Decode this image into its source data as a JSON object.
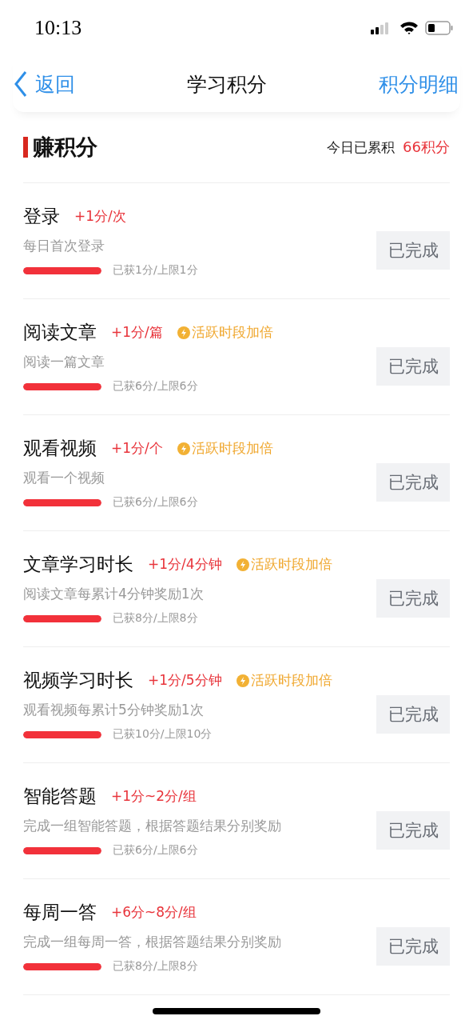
{
  "status_bar": {
    "time": "10:13"
  },
  "nav": {
    "back": "返回",
    "title": "学习积分",
    "action": "积分明细"
  },
  "section": {
    "title": "赚积分",
    "today_label": "今日已累积",
    "today_value": "66积分"
  },
  "tasks": [
    {
      "title": "登录",
      "rate": "+1分/次",
      "desc": "每日首次登录",
      "level": 1,
      "progress": "已获1分/上限1分",
      "button": "已完成",
      "completed": true
    },
    {
      "title": "阅读文章",
      "rate": "+1分/篇",
      "bonus": "活跃时段加倍",
      "desc": "阅读一篇文章",
      "level": 1,
      "progress": "已获6分/上限6分",
      "button": "已完成",
      "completed": true
    },
    {
      "title": "观看视频",
      "rate": "+1分/个",
      "bonus": "活跃时段加倍",
      "desc": "观看一个视频",
      "level": 1,
      "progress": "已获6分/上限6分",
      "button": "已完成",
      "completed": true
    },
    {
      "title": "文章学习时长",
      "rate": "+1分/4分钟",
      "bonus": "活跃时段加倍",
      "desc": "阅读文章每累计4分钟奖励1次",
      "level": 1,
      "progress": "已获8分/上限8分",
      "button": "已完成",
      "completed": true
    },
    {
      "title": "视频学习时长",
      "rate": "+1分/5分钟",
      "bonus": "活跃时段加倍",
      "desc": "观看视频每累计5分钟奖励1次",
      "level": 1,
      "progress": "已获10分/上限10分",
      "button": "已完成",
      "completed": true
    },
    {
      "title": "智能答题",
      "rate": "+1分~2分/组",
      "desc": "完成一组智能答题，根据答题结果分别奖励",
      "level": 1,
      "progress": "已获6分/上限6分",
      "button": "已完成",
      "completed": true
    },
    {
      "title": "每周一答",
      "rate": "+6分~8分/组",
      "desc": "完成一组每周一答，根据答题结果分别奖励",
      "level": 1,
      "progress": "已获8分/上限8分",
      "button": "已完成",
      "completed": true
    }
  ]
}
